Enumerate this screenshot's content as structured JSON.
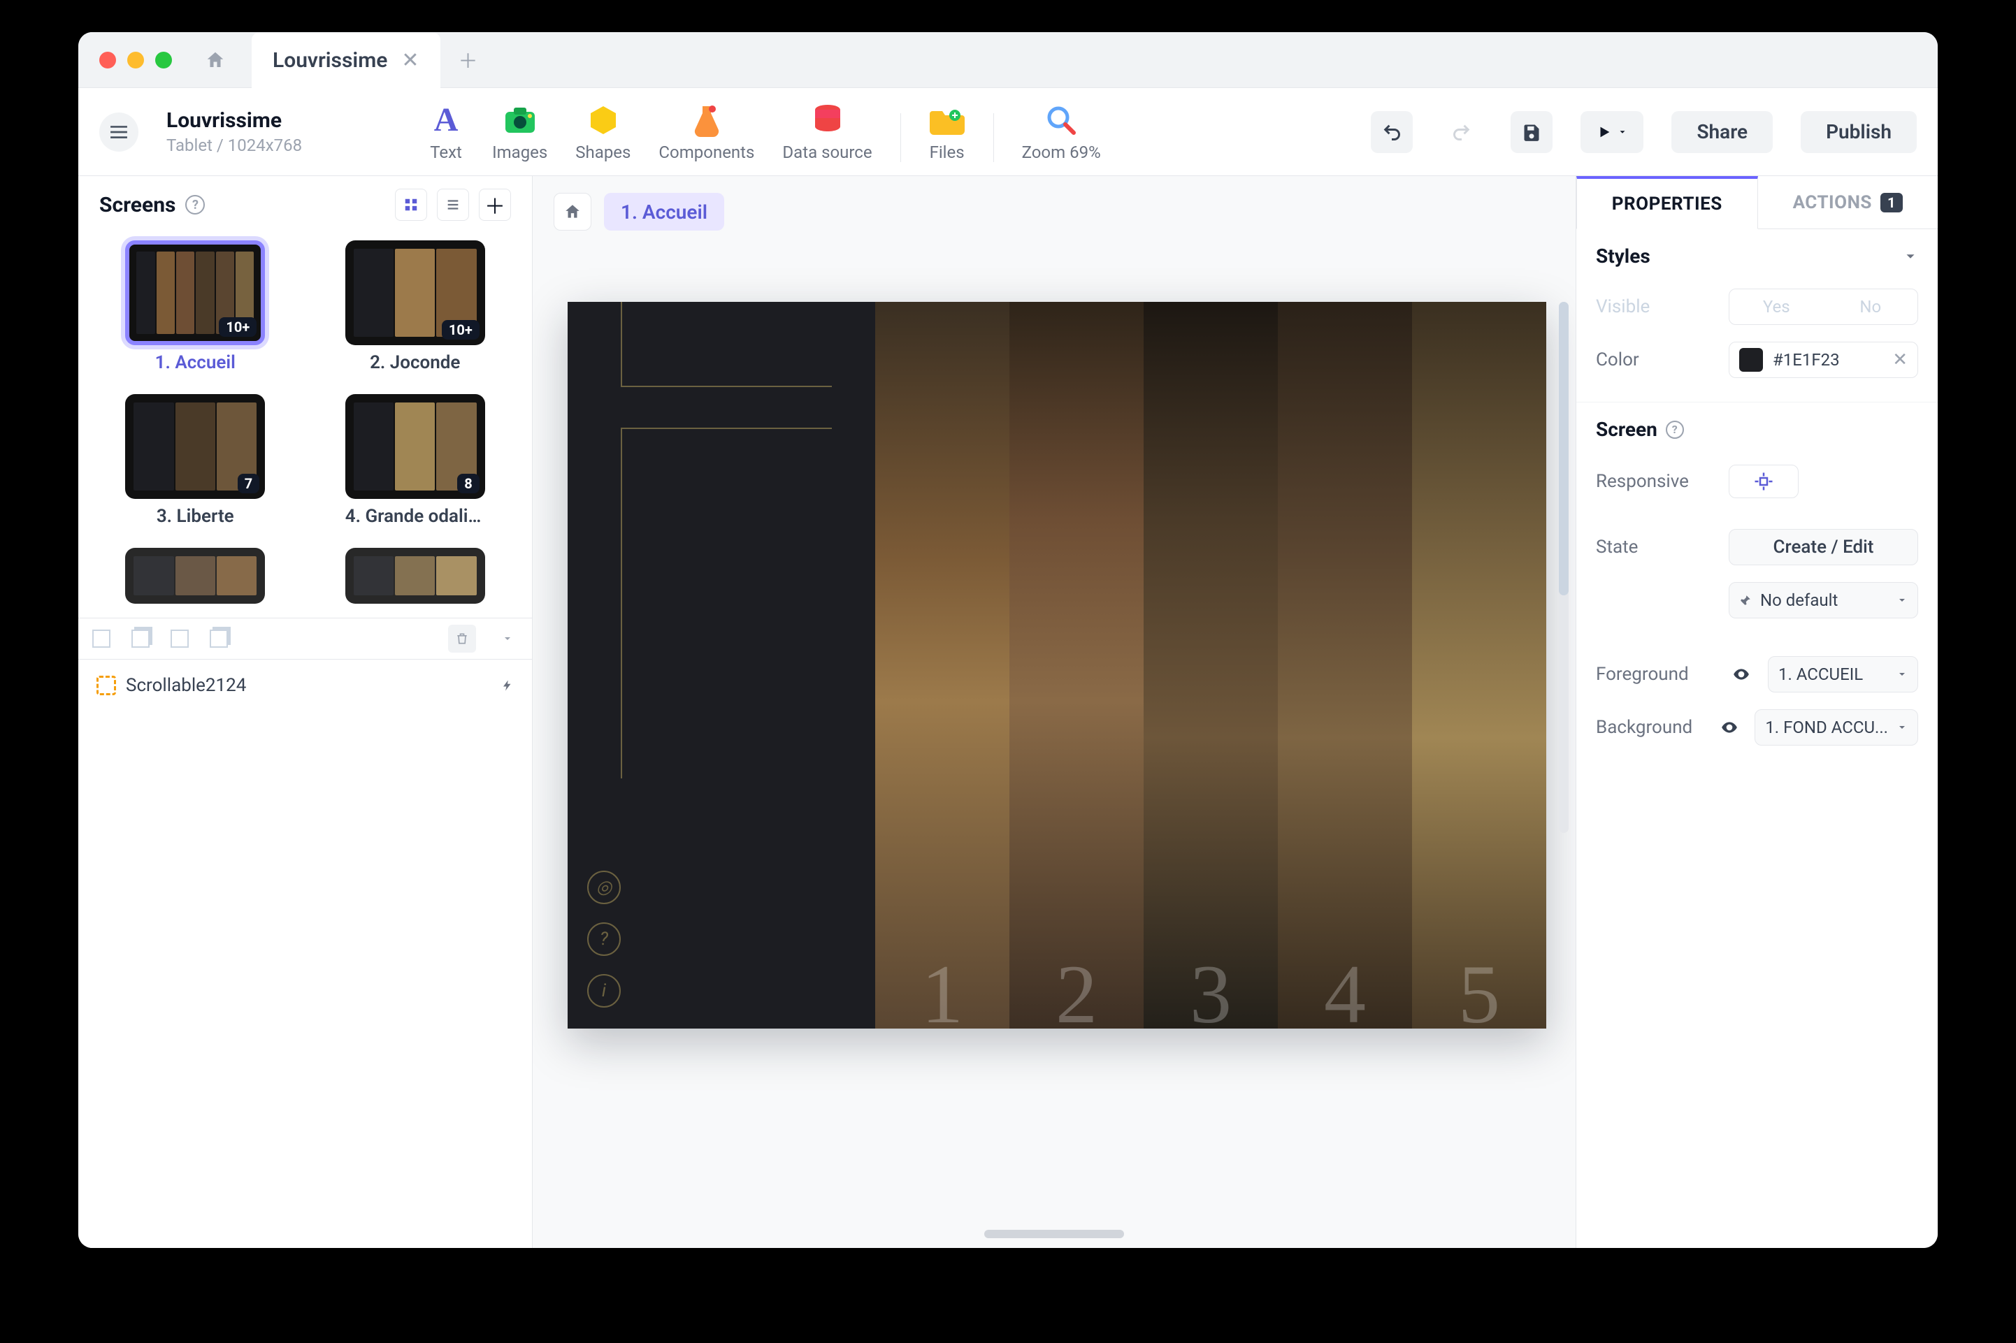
{
  "tabs": {
    "active_label": "Louvrissime"
  },
  "project": {
    "name": "Louvrissime",
    "device": "Tablet / 1024x768"
  },
  "maintools": {
    "text": "Text",
    "images": "Images",
    "shapes": "Shapes",
    "components": "Components",
    "datasource": "Data source",
    "files": "Files",
    "zoom": "Zoom 69%"
  },
  "actions": {
    "share": "Share",
    "publish": "Publish"
  },
  "left": {
    "header": "Screens",
    "screens": [
      {
        "label": "1. Accueil",
        "badge": "10+",
        "selected": true
      },
      {
        "label": "2. Joconde",
        "badge": "10+"
      },
      {
        "label": "3. Liberte",
        "badge": "7"
      },
      {
        "label": "4. Grande odalis...",
        "badge": "8"
      }
    ],
    "tree_item": "Scrollable2124"
  },
  "crumb": {
    "current": "1. Accueil"
  },
  "artboard": {
    "bg_color": "#1c1d22",
    "strip_numbers": [
      "1",
      "2",
      "3",
      "4",
      "5"
    ],
    "strip_colors": [
      [
        "#5a4632",
        "#7b5a36",
        "#9c7a4b",
        "#3a2f22"
      ],
      [
        "#3d2f24",
        "#6e4e34",
        "#8a6a47",
        "#2e2419"
      ],
      [
        "#23201a",
        "#4a3a28",
        "#6d563a",
        "#1c1712"
      ],
      [
        "#352a1e",
        "#5a4530",
        "#7e6543",
        "#2a2118"
      ],
      [
        "#4a3b28",
        "#77623f",
        "#a08654",
        "#3a2f20"
      ]
    ]
  },
  "right": {
    "tab_properties": "PROPERTIES",
    "tab_actions": "ACTIONS",
    "actions_count": "1",
    "styles_header": "Styles",
    "visible_label": "Visible",
    "visible_yes": "Yes",
    "visible_no": "No",
    "color_label": "Color",
    "color_value": "#1E1F23",
    "screen_header": "Screen",
    "responsive_label": "Responsive",
    "state_label": "State",
    "state_button": "Create / Edit",
    "state_default": "No default",
    "foreground_label": "Foreground",
    "foreground_value": "1. ACCUEIL",
    "background_label": "Background",
    "background_value": "1. FOND ACCU..."
  }
}
